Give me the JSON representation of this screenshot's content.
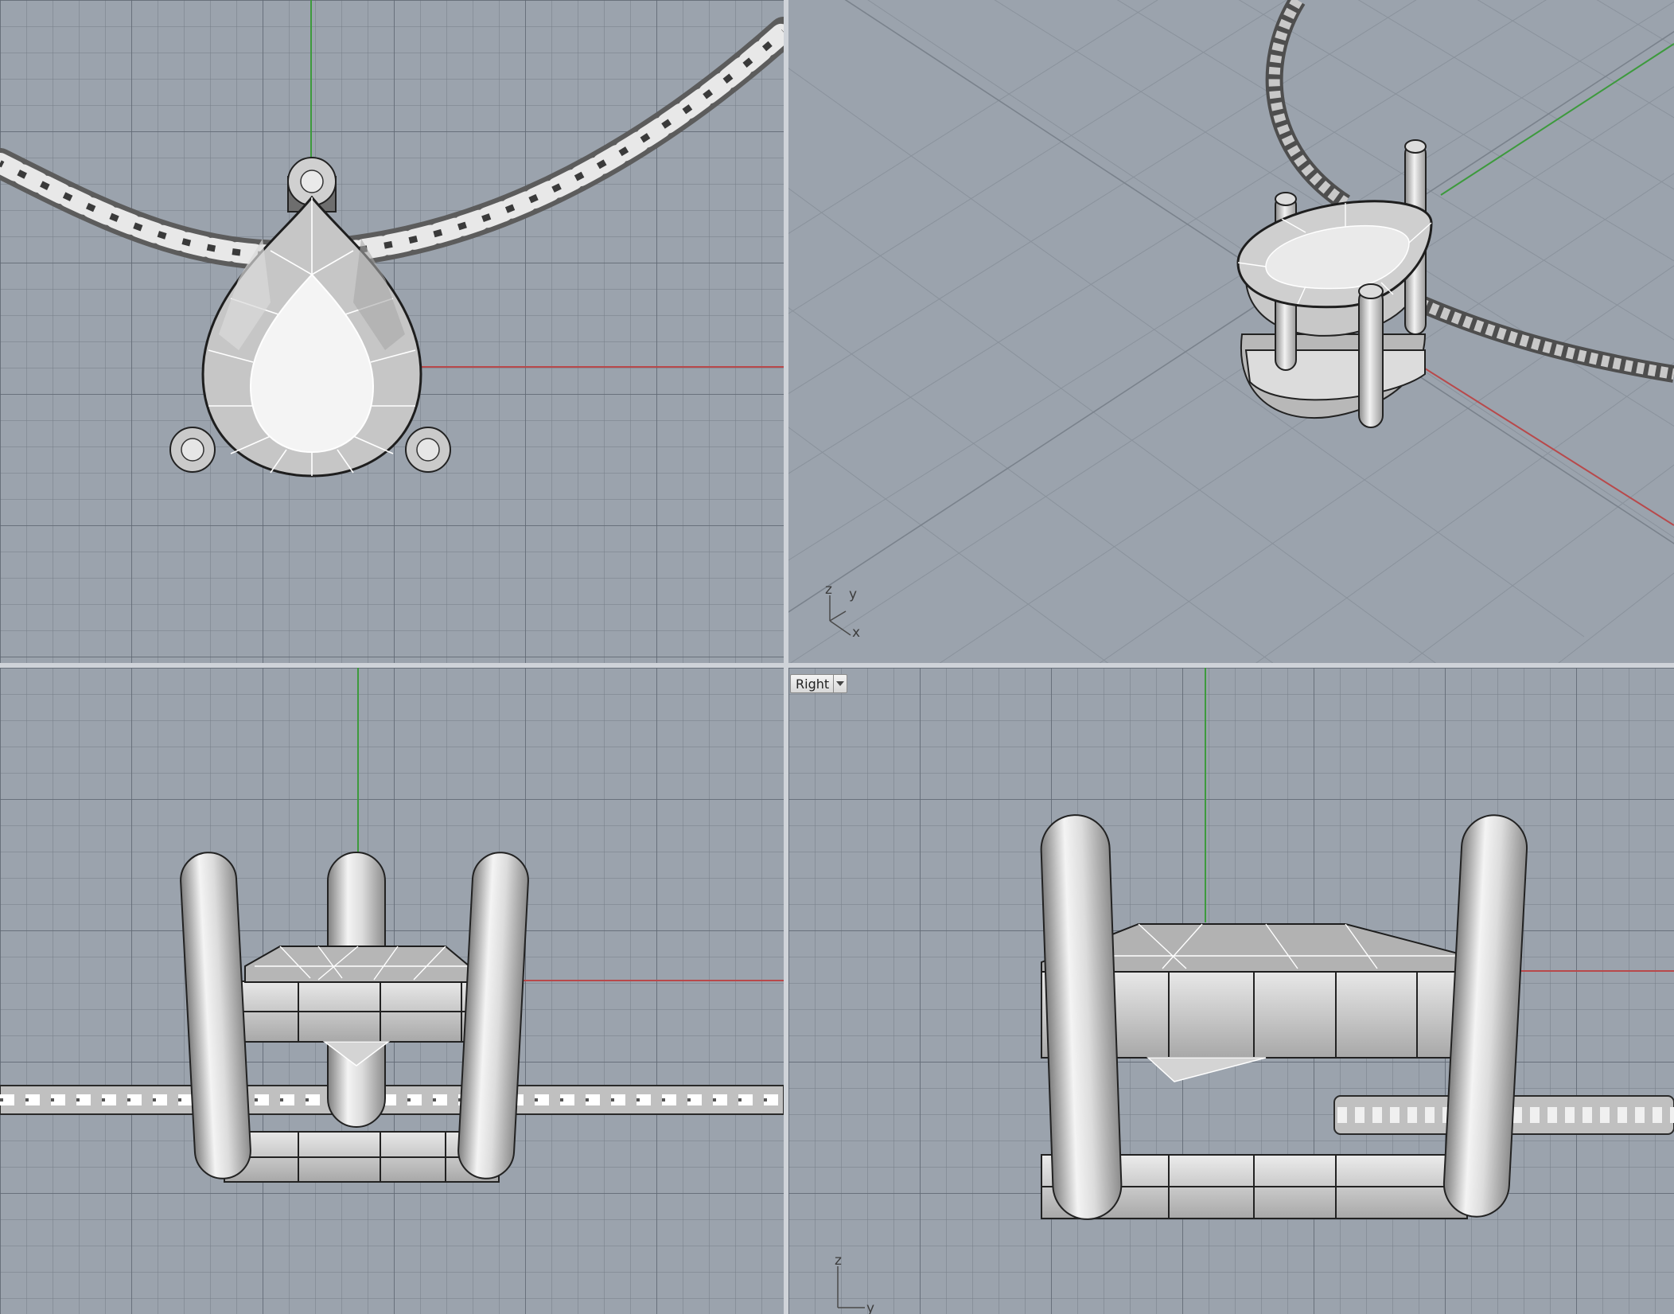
{
  "viewports": {
    "top": {
      "name": ""
    },
    "perspective": {
      "name": "",
      "gizmo": {
        "z": "z",
        "y": "y",
        "x": "x"
      }
    },
    "front": {
      "name": ""
    },
    "right": {
      "name": "Right",
      "gizmo": {
        "z": "z",
        "y": "y"
      }
    }
  },
  "colors": {
    "background": "#9ba3ad",
    "grid_minor": "#8e96a0",
    "grid_major": "#7c848f",
    "x_axis": "#b8494b",
    "y_axis": "#3d9a3d",
    "separator": "#cfd3d9"
  },
  "icons": {
    "viewport_menu": "chevron-down-icon"
  }
}
